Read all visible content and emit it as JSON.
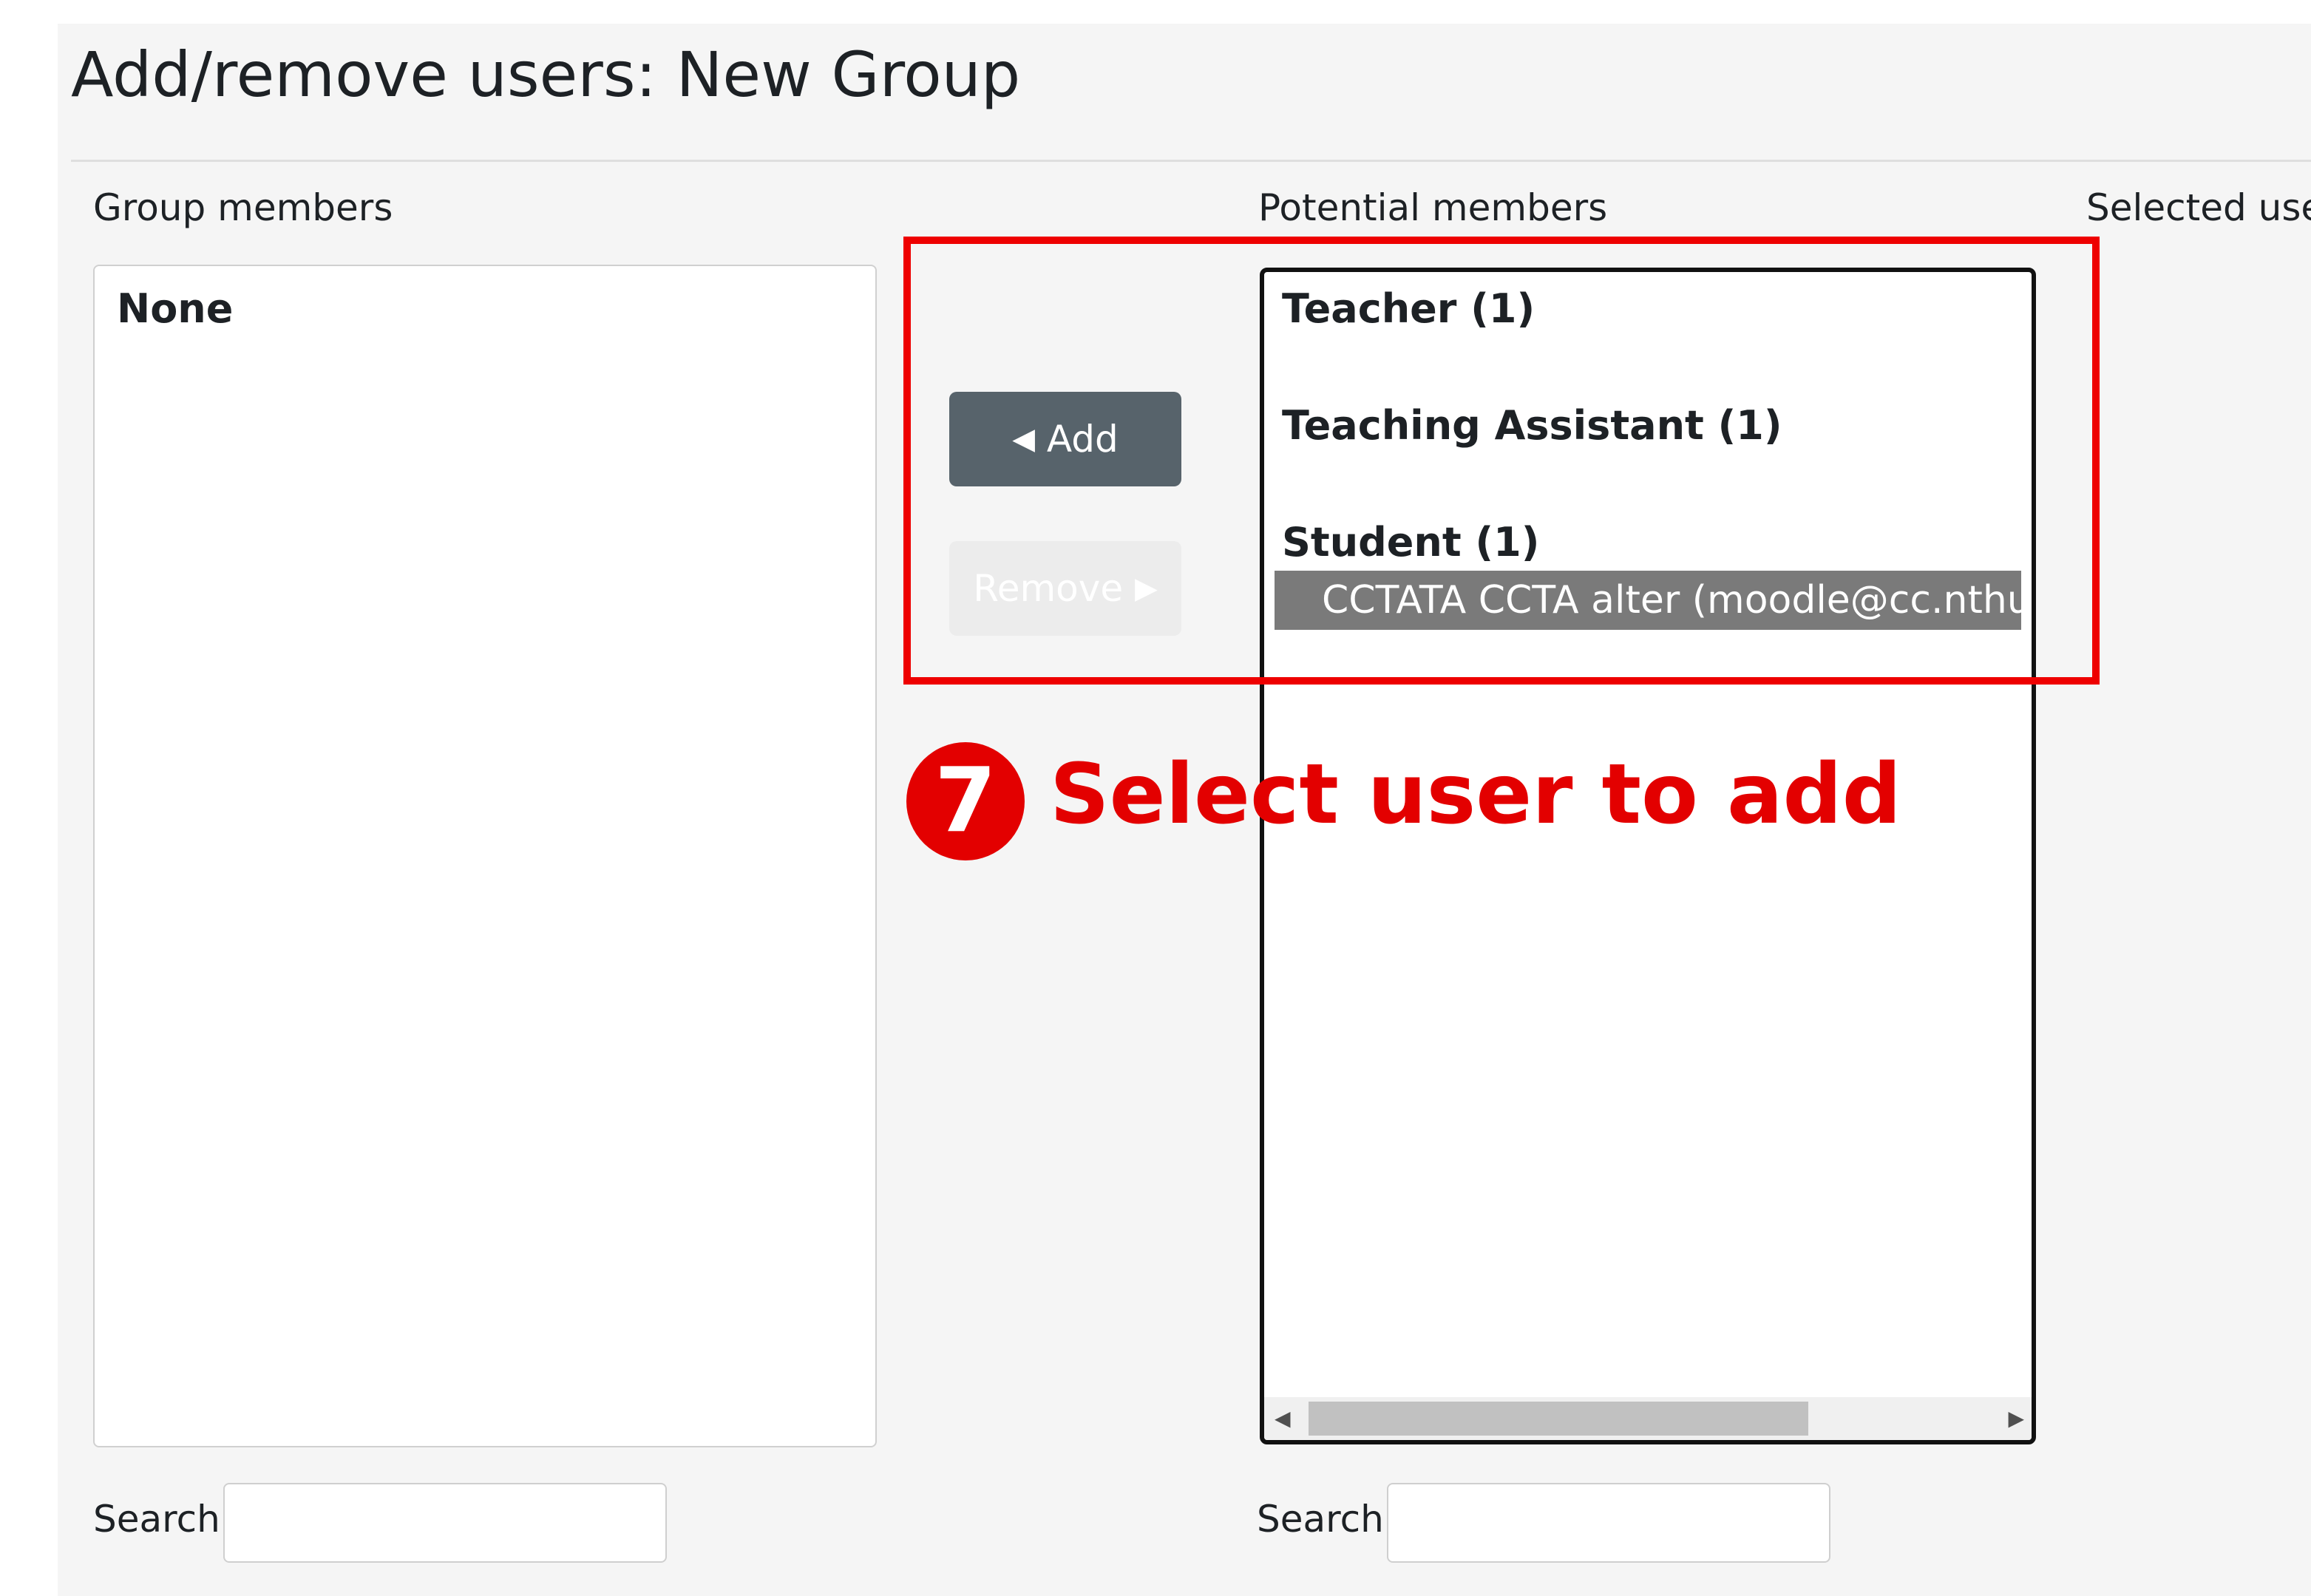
{
  "page": {
    "title": "Add/remove users: New Group"
  },
  "group_members": {
    "label": "Group members",
    "options": [
      {
        "label": "None"
      }
    ]
  },
  "potential_members": {
    "label": "Potential members",
    "groups": [
      {
        "label": "Teacher (1)"
      },
      {
        "label": "Teaching Assistant (1)"
      },
      {
        "label": "Student (1)"
      }
    ],
    "selected_option": "CCTATA CCTA alter (moodle@cc.nthu.edu.tw)"
  },
  "selected_user": {
    "label": "Selected use"
  },
  "buttons": {
    "add_label": "Add",
    "add_glyph": "◀",
    "remove_label": "Remove",
    "remove_glyph": "▶"
  },
  "search": {
    "left_label": "Search",
    "right_label": "Search",
    "left_value": "",
    "right_value": ""
  },
  "annotation": {
    "step_number": "7",
    "text": "Select user to add",
    "color": "#e30000"
  },
  "colors": {
    "add_button": "#57636b",
    "selection": "#7a7a7a",
    "background": "#f5f5f5"
  }
}
